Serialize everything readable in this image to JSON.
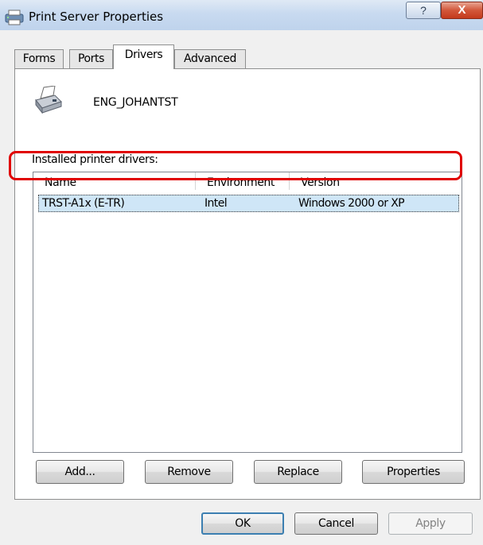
{
  "window": {
    "title": "Print Server Properties",
    "help_glyph": "?",
    "close_glyph": "X",
    "icon": "print-server-icon"
  },
  "tabs": [
    {
      "label": "Forms",
      "active": false
    },
    {
      "label": "Ports",
      "active": false
    },
    {
      "label": "Drivers",
      "active": true
    },
    {
      "label": "Advanced",
      "active": false
    }
  ],
  "drivers_page": {
    "server_name": "ENG_JOHANTST",
    "server_icon": "printer-fax-icon",
    "list_label": "Installed printer drivers:",
    "columns": [
      "Name",
      "Environment",
      "Version"
    ],
    "rows": [
      {
        "name": "TRST-A1x (E-TR)",
        "environment": "Intel",
        "version": "Windows 2000 or XP",
        "selected": true
      }
    ],
    "buttons": {
      "add": "Add...",
      "remove": "Remove",
      "replace": "Replace",
      "properties": "Properties"
    }
  },
  "dialog_buttons": {
    "ok": "OK",
    "cancel": "Cancel",
    "apply": "Apply",
    "apply_enabled": false
  },
  "colors": {
    "selection": "#cfe6f7",
    "annotation": "#e00000"
  }
}
